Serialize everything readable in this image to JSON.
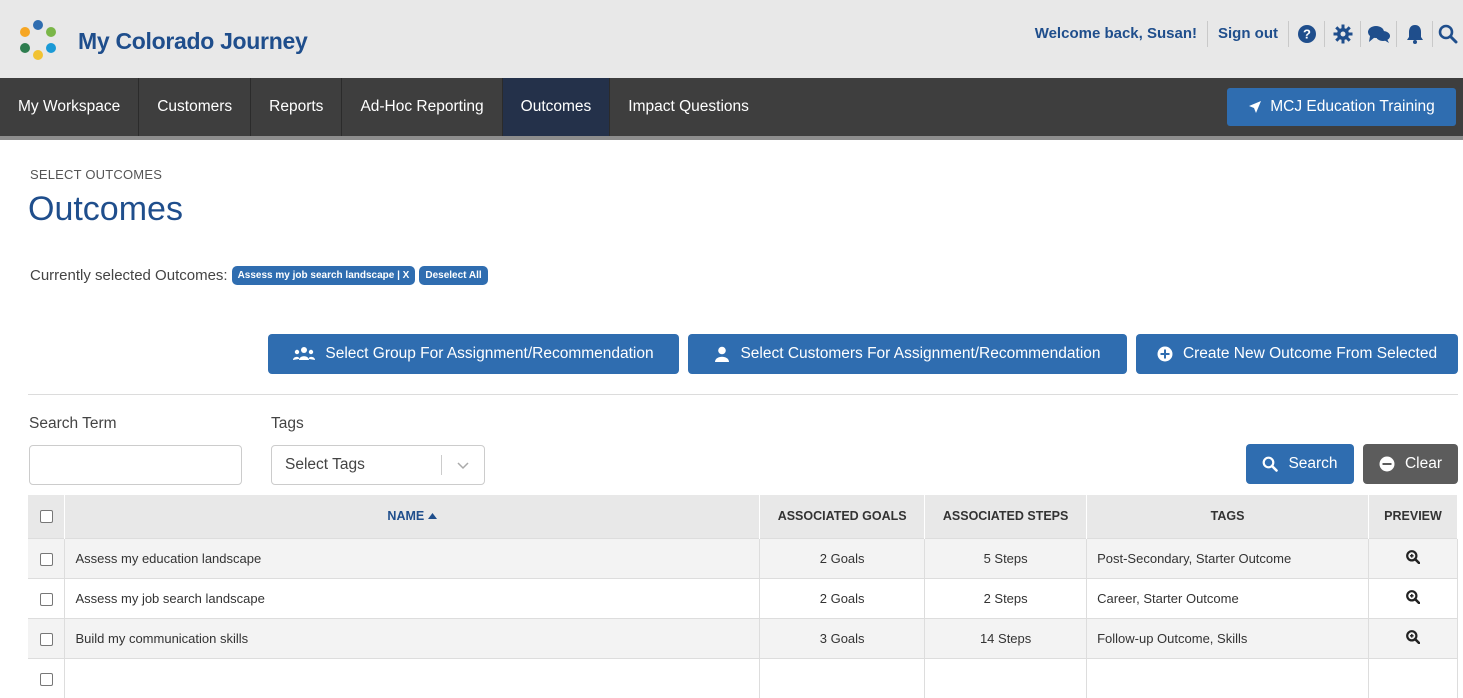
{
  "header": {
    "brand": "My Colorado Journey",
    "welcome": "Welcome back, Susan!",
    "sign_out": "Sign out",
    "icons": [
      "help-icon",
      "gear-icon",
      "chat-icon",
      "bell-icon",
      "search-icon"
    ]
  },
  "nav": {
    "items": [
      {
        "label": "My Workspace"
      },
      {
        "label": "Customers"
      },
      {
        "label": "Reports"
      },
      {
        "label": "Ad-Hoc Reporting"
      },
      {
        "label": "Outcomes",
        "active": true
      },
      {
        "label": "Impact Questions"
      }
    ],
    "training_button": "MCJ Education Training"
  },
  "page": {
    "breadcrumb": "SELECT OUTCOMES",
    "title": "Outcomes",
    "selected_label": "Currently selected Outcomes:",
    "selected_pill": "Assess my job search landscape | X",
    "deselect_all": "Deselect All"
  },
  "actions": {
    "group": "Select Group For Assignment/Recommendation",
    "customers": "Select Customers For Assignment/Recommendation",
    "create": "Create New Outcome From Selected"
  },
  "filters": {
    "search_label": "Search Term",
    "search_value": "",
    "tags_label": "Tags",
    "tags_placeholder": "Select Tags",
    "search_button": "Search",
    "clear_button": "Clear"
  },
  "table": {
    "headers": {
      "name": "NAME",
      "goals": "ASSOCIATED GOALS",
      "steps": "ASSOCIATED STEPS",
      "tags": "TAGS",
      "preview": "PREVIEW"
    },
    "rows": [
      {
        "name": "Assess my education landscape",
        "goals": "2 Goals",
        "steps": "5 Steps",
        "tags": "Post-Secondary, Starter Outcome"
      },
      {
        "name": "Assess my job search landscape",
        "goals": "2 Goals",
        "steps": "2 Steps",
        "tags": "Career, Starter Outcome"
      },
      {
        "name": "Build my communication skills",
        "goals": "3 Goals",
        "steps": "14 Steps",
        "tags": "Follow-up Outcome, Skills"
      }
    ]
  },
  "colors": {
    "primary_blue": "#2f6db0",
    "brand_blue": "#1f4e8c",
    "nav_bg": "#3e3e3e",
    "nav_active": "#24314a",
    "clear_gray": "#5c5c5c"
  }
}
